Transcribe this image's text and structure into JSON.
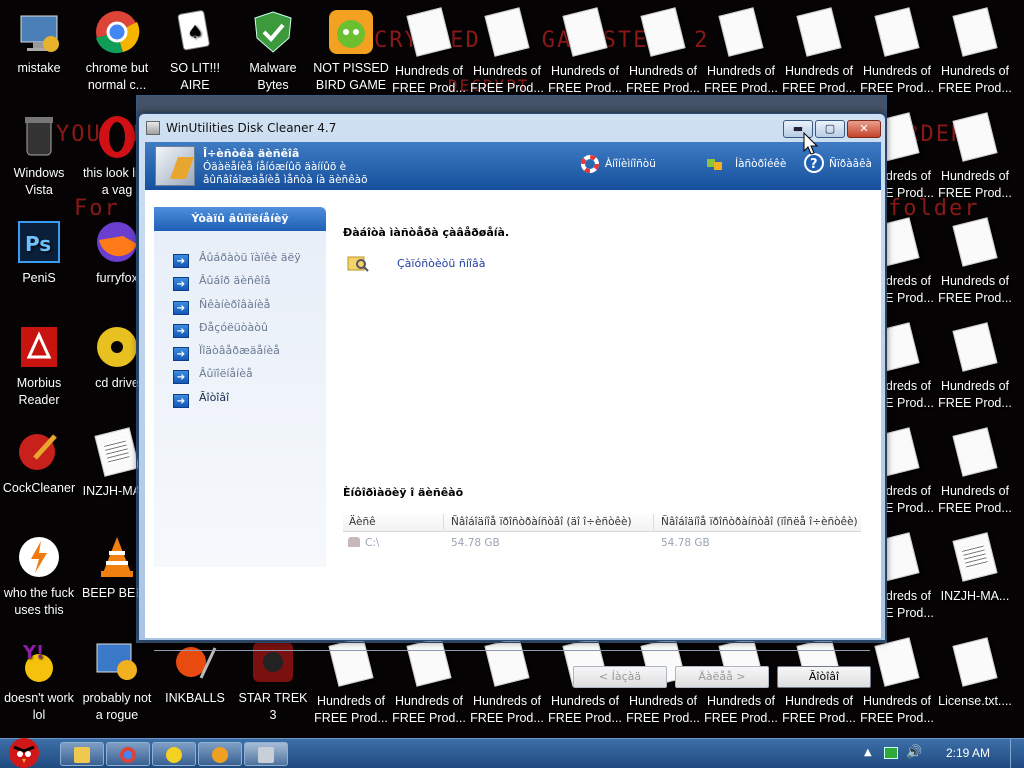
{
  "desktop": {
    "icons_col1": [
      {
        "label": "mistake"
      },
      {
        "label": "Windows Vista"
      },
      {
        "label": "PeniS"
      },
      {
        "label": "Morbius Reader"
      },
      {
        "label": "CockCleaner"
      },
      {
        "label": "who the fuck uses this"
      },
      {
        "label": "doesn't work lol"
      }
    ],
    "icons_col2": [
      {
        "label": "chrome but normal c..."
      },
      {
        "label": "this look like a vag"
      },
      {
        "label": "furryfox"
      },
      {
        "label": "cd drive"
      },
      {
        "label": "INZJH-MA..."
      },
      {
        "label": "BEEP BEEP"
      },
      {
        "label": "probably not a rogue"
      }
    ],
    "icons_top": [
      {
        "label": "SO LIT!!! AIRE"
      },
      {
        "label": "Malware Bytes"
      },
      {
        "label": "NOT PISSED BIRD GAME"
      },
      {
        "label": "Hundreds of FREE Prod..."
      }
    ],
    "icons_bottom": [
      {
        "label": "INKBALLS"
      },
      {
        "label": "STAR TREK 3"
      },
      {
        "label": "Hundreds of FREE Prod..."
      },
      {
        "label": "License.txt...."
      }
    ],
    "icons_right_col": [
      {
        "label": "Hundreds of FREE Prod..."
      },
      {
        "label": "INZJH-MA..."
      }
    ],
    "bg_text": [
      "CRYPTED BY GANGSTERA 2",
      "YOUR FILES",
      "For fu",
      "folder",
      "DECRYPT",
      "ORDER"
    ]
  },
  "window": {
    "title": "WinUtilities Disk Cleaner 4.7",
    "header_title": "Î÷èñòêà äèñêîâ",
    "header_desc": "Óäàëåíèå íåíóæíûõ äàííûõ è âûñâîáîæäåíèå ìåñòà íà äèñêàõ",
    "header_links": [
      "Àíîíèìíîñòü",
      "Íàñòðîéêè",
      "Ñïðàâêà"
    ],
    "sidebar_title": "Ýòàïû âûïîëíåíèÿ",
    "sidebar_items": [
      "Âûáðàòü ïàïêè äëÿ",
      "Âûáîð äèñêîâ",
      "Ñêàíèðîâàíèå",
      "Ðåçóëüòàòû",
      "Ïîäòâåðæäåíèå",
      "Âûïîëíåíèå",
      "Ãîòîâî"
    ],
    "main_title": "Ðàáîòà ìàñòåðà çàâåðøåíà.",
    "task_link": "Çàïóñòèòü ñíîâà",
    "drives_title": "Èíôîðìàöèÿ î äèñêàõ",
    "table_headers": [
      "Äèñê",
      "Ñâîáîäíîå ïðîñòðàíñòâî (äî î÷èñòêè)",
      "Ñâîáîäíîå ïðîñòðàíñòâî (ïîñëå î÷èñòêè)"
    ],
    "table_rows": [
      {
        "drive": "C:\\",
        "before": "54.78 GB",
        "after": "54.78 GB"
      }
    ],
    "btn_back": "< Íàçàä",
    "btn_next": "Äàëåå >",
    "btn_finish": "Ãîòîâî"
  },
  "taskbar": {
    "clock": "2:19 AM"
  },
  "colors": {
    "bg_text": "#8a1818",
    "header_blue": "#1f5fb5",
    "link_blue": "#1f3f9f"
  }
}
